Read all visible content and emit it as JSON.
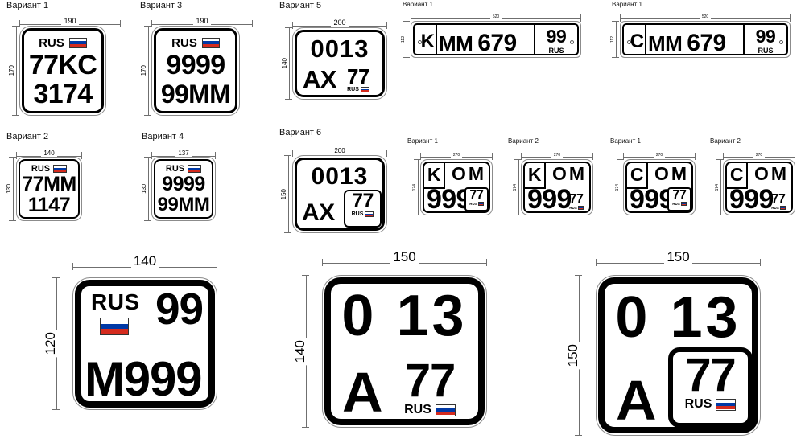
{
  "document": {
    "type": "technical-drawing",
    "subject": "Russian license plate format variants with dimensions in millimetres",
    "labels": {
      "variant_word": "Вариант"
    }
  },
  "common": {
    "rus_text": "RUS",
    "flag_name": "russian-flag",
    "flag_colors": {
      "white": "#ffffff",
      "blue": "#0039a6",
      "red": "#d52b1e"
    }
  },
  "plates": [
    {
      "id": "p1",
      "variant": "Вариант 1",
      "width_mm": "190",
      "height_mm": "170",
      "line1": "77KC",
      "line2": "3174",
      "header": "RUS",
      "has_flag": true,
      "style": "square-rus-top"
    },
    {
      "id": "p2",
      "variant": "Вариант 3",
      "width_mm": "190",
      "height_mm": "170",
      "line1": "9999",
      "line2": "99MM",
      "header": "RUS",
      "has_flag": true,
      "style": "square-rus-top"
    },
    {
      "id": "p3",
      "variant": "Вариант 5",
      "width_mm": "200",
      "height_mm": "140",
      "line1": "0013",
      "line2": "AX",
      "region": "77",
      "region_sub": "RUS",
      "has_flag": true,
      "style": "square-region-open"
    },
    {
      "id": "p4",
      "variant": "Вариант 1",
      "width_mm": "520",
      "height_mm": "112",
      "prefix": "K",
      "letters": "MM",
      "digits": "679",
      "region": "99",
      "region_sub": "RUS",
      "has_flag": false,
      "style": "wide-eu"
    },
    {
      "id": "p5",
      "variant": "Вариант 1",
      "width_mm": "520",
      "height_mm": "112",
      "prefix": "C",
      "letters": "MM",
      "digits": "679",
      "region": "99",
      "region_sub": "RUS",
      "has_flag": false,
      "style": "wide-eu"
    },
    {
      "id": "p6",
      "variant": "Вариант 2",
      "width_mm": "140",
      "height_mm": "130",
      "line1": "77MM",
      "line2": "1147",
      "header": "RUS",
      "has_flag": true,
      "style": "square-rus-top"
    },
    {
      "id": "p7",
      "variant": "Вариант 4",
      "width_mm": "137",
      "height_mm": "130",
      "line1": "9999",
      "line2": "99MM",
      "header": "RUS",
      "has_flag": true,
      "style": "square-rus-top"
    },
    {
      "id": "p8",
      "variant": "Вариант 6",
      "width_mm": "200",
      "height_mm": "150",
      "line1": "0013",
      "line2": "AX",
      "region": "77",
      "region_sub": "RUS",
      "has_flag": true,
      "style": "square-region-boxed"
    },
    {
      "id": "p9",
      "variant": "Вариант 1",
      "width_mm": "270",
      "height_mm": "174",
      "prefix": "K",
      "letters": "OM",
      "digits": "999",
      "region": "77",
      "region_sub": "RUS",
      "has_flag": true,
      "style": "moto-boxed"
    },
    {
      "id": "p10",
      "variant": "Вариант 2",
      "width_mm": "270",
      "height_mm": "174",
      "prefix": "K",
      "letters": "OM",
      "digits": "999",
      "region": "77",
      "region_sub": "RUS",
      "has_flag": true,
      "style": "moto-open"
    },
    {
      "id": "p11",
      "variant": "Вариант 1",
      "width_mm": "270",
      "height_mm": "174",
      "prefix": "C",
      "letters": "OM",
      "digits": "999",
      "region": "77",
      "region_sub": "RUS",
      "has_flag": true,
      "style": "moto-boxed"
    },
    {
      "id": "p12",
      "variant": "Вариант 2",
      "width_mm": "270",
      "height_mm": "174",
      "prefix": "C",
      "letters": "OM",
      "digits": "999",
      "region": "77",
      "region_sub": "RUS",
      "has_flag": true,
      "style": "moto-open"
    },
    {
      "id": "p13",
      "variant": "",
      "width_mm": "140",
      "height_mm": "120",
      "header": "RUS",
      "region": "99",
      "line2": "M999",
      "has_flag": true,
      "style": "big-rus-flag-region"
    },
    {
      "id": "p14",
      "variant": "",
      "width_mm": "150",
      "height_mm": "140",
      "line1": "0 13",
      "line2": "A",
      "region": "77",
      "region_sub": "RUS",
      "has_flag": true,
      "style": "big-region-open"
    },
    {
      "id": "p15",
      "variant": "",
      "width_mm": "150",
      "height_mm": "150",
      "line1": "0 13",
      "line2": "A",
      "region": "77",
      "region_sub": "RUS",
      "has_flag": true,
      "style": "big-region-boxed"
    }
  ]
}
